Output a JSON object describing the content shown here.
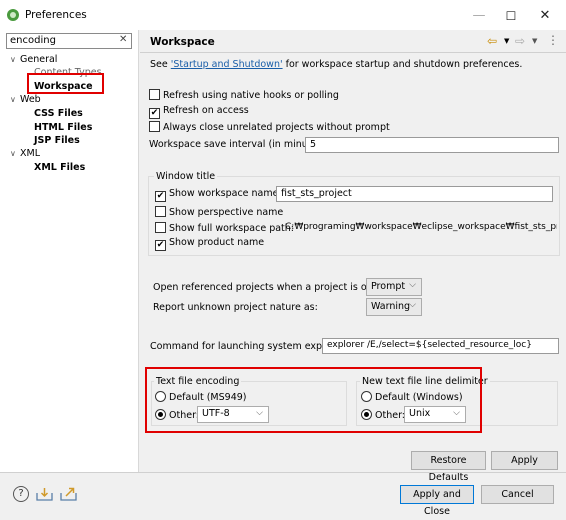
{
  "window": {
    "title": "Preferences",
    "minimize": "—",
    "maximize": "☐",
    "close": "✕"
  },
  "filter": {
    "value": "encoding",
    "clear": "✕"
  },
  "tree": {
    "general": "General",
    "content_types": "Content Types",
    "workspace": "Workspace",
    "web": "Web",
    "css_files": "CSS Files",
    "html_files": "HTML Files",
    "jsp_files": "JSP Files",
    "xml": "XML",
    "xml_files": "XML Files",
    "expanded_arrow": "∨"
  },
  "page": {
    "title": "Workspace",
    "see_prefix": "See ",
    "see_link": "'Startup and Shutdown'",
    "see_suffix": " for workspace startup and shutdown preferences.",
    "refresh_native": "Refresh using native hooks or polling",
    "refresh_access": "Refresh on access",
    "always_close": "Always close unrelated projects without prompt",
    "save_interval_label": "Workspace save interval (in minutes):",
    "save_interval_value": "5"
  },
  "window_title": {
    "group": "Window title",
    "show_ws_name": "Show workspace name:",
    "ws_name_value": "fist_sts_project",
    "show_perspective": "Show perspective name",
    "show_full_path": "Show full workspace path:",
    "full_path_value": "C:₩programing₩workspace₩eclipse_workspace₩fist_sts_project",
    "show_product": "Show product name"
  },
  "projects": {
    "open_referenced_label": "Open referenced projects when a project is opened:",
    "open_referenced_value": "Prompt",
    "report_unknown_label": "Report unknown project nature as:",
    "report_unknown_value": "Warning",
    "command_label": "Command for launching system explorer:",
    "command_value": "explorer /E,/select=${selected_resource_loc}"
  },
  "encoding": {
    "group": "Text file encoding",
    "default_label": "Default (MS949)",
    "other_label": "Other:",
    "other_value": "UTF-8"
  },
  "delimiter": {
    "group": "New text file line delimiter",
    "default_label": "Default (Windows)",
    "other_label": "Other:",
    "other_value": "Unix"
  },
  "buttons": {
    "restore_defaults": "Restore Defaults",
    "apply": "Apply",
    "apply_close": "Apply and Close",
    "cancel": "Cancel"
  },
  "nav": {
    "back": "⇦",
    "forward": "⇨",
    "dropdown": "▼",
    "menu": "⋮"
  },
  "checks": {
    "refresh_native": false,
    "refresh_access": true,
    "always_close": false,
    "show_ws_name": true,
    "show_perspective": false,
    "show_full_path": false,
    "show_product": true
  },
  "glyphs": {
    "check": "✔",
    "chevron": "⌵",
    "help": "?"
  },
  "colors": {
    "highlight": "#e00000",
    "link": "#1a5ea8",
    "default_button_border": "#0078d7"
  }
}
